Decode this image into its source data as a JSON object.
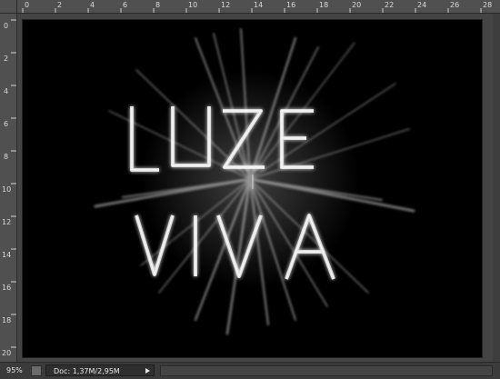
{
  "statusbar": {
    "zoom": "95%",
    "doc_info": "Doc: 1,37M/2,95M"
  },
  "ruler": {
    "horizontal_ticks": [
      "0",
      "2",
      "4",
      "6",
      "8",
      "10",
      "12",
      "14",
      "16",
      "18",
      "20",
      "22",
      "24",
      "26",
      "28"
    ],
    "vertical_ticks": [
      "0",
      "2",
      "4",
      "6",
      "8",
      "10",
      "12",
      "14",
      "16",
      "18",
      "20"
    ]
  },
  "artwork": {
    "line1": "LUZE",
    "line2": "VIVA",
    "glow_color": "#f2f2f2",
    "background": "#000000"
  }
}
